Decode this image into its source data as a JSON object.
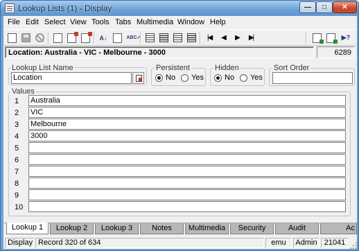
{
  "window": {
    "title": "Lookup Lists (1) - Display",
    "minimize_glyph": "—",
    "maximize_glyph": "□",
    "close_glyph": "✕"
  },
  "menu": [
    "File",
    "Edit",
    "Select",
    "View",
    "Tools",
    "Tabs",
    "Multimedia",
    "Window",
    "Help"
  ],
  "toolbar": {
    "icons": [
      "new-record-icon",
      "save-icon",
      "cancel-icon",
      "new-page-icon",
      "duplicate-icon",
      "delete-icon",
      "sort-icon",
      "edit-icon",
      "spell-check-icon",
      "list-view-icon",
      "table-view-icon",
      "form-view-icon",
      "print-view-icon",
      "first-record-icon",
      "previous-record-icon",
      "next-record-icon",
      "last-record-icon",
      "export-icon",
      "report-icon",
      "help-pointer-icon"
    ],
    "sort_glyph": "A↓",
    "spell_glyph": "ABC✓",
    "first_glyph": "|◀",
    "prev_glyph": "◀",
    "next_glyph": "▶",
    "last_glyph": "▶|",
    "help_glyph": "▶?"
  },
  "location_bar": {
    "text": "Location: Australia - VIC - Melbourne - 3000",
    "record_count": "6289"
  },
  "form": {
    "lookup_list_name": {
      "label": "Lookup List Name",
      "value": "Location"
    },
    "persistent": {
      "label": "Persistent",
      "options": [
        "No",
        "Yes"
      ],
      "selected": "No"
    },
    "hidden": {
      "label": "Hidden",
      "options": [
        "No",
        "Yes"
      ],
      "selected": "No"
    },
    "sort_order": {
      "label": "Sort Order",
      "value": ""
    }
  },
  "values": {
    "label": "Values",
    "rows": [
      {
        "num": "1",
        "value": "Australia"
      },
      {
        "num": "2",
        "value": "VIC"
      },
      {
        "num": "3",
        "value": "Melbourne"
      },
      {
        "num": "4",
        "value": "3000"
      },
      {
        "num": "5",
        "value": ""
      },
      {
        "num": "6",
        "value": ""
      },
      {
        "num": "7",
        "value": ""
      },
      {
        "num": "8",
        "value": ""
      },
      {
        "num": "9",
        "value": ""
      },
      {
        "num": "10",
        "value": ""
      }
    ]
  },
  "tabs": [
    "Lookup 1",
    "Lookup 2",
    "Lookup 3",
    "Notes",
    "Multimedia",
    "Security",
    "Audit",
    "Ac"
  ],
  "active_tab": "Lookup 1",
  "status": {
    "mode": "Display",
    "record": "Record 320 of 634",
    "user_short": "emu",
    "user": "Admin",
    "number": "21041"
  },
  "colors": {
    "title_bar": "#6fa3d8",
    "close_button": "#c9462a",
    "inactive_tab": "#b7b7b7",
    "window_bg": "#f0f0f0"
  }
}
